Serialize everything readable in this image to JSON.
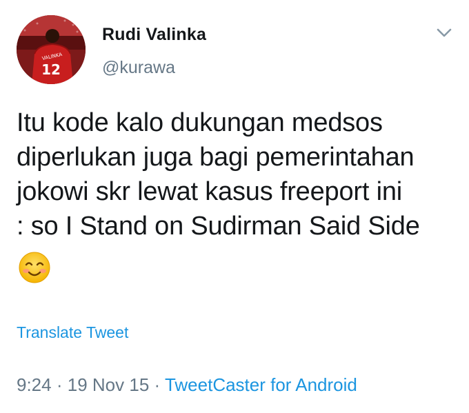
{
  "user": {
    "display_name": "Rudi Valinka",
    "handle": "@kurawa",
    "avatar_jersey_name": "VALINKA",
    "avatar_jersey_number": "12"
  },
  "tweet": {
    "text": "Itu kode kalo dukungan medsos\ndiperlukan juga bagi pemerintahan\njokowi skr lewat kasus freeport ini\n: so I Stand on Sudirman Said Side",
    "emoji": "☺️",
    "translate_label": "Translate Tweet"
  },
  "meta": {
    "time": "9:24",
    "date": "19 Nov 15",
    "separator": "·",
    "source": "TweetCaster for Android"
  },
  "icons": {
    "menu": "chevron-down-icon",
    "emoji": "smiling-face-icon"
  },
  "colors": {
    "link": "#1b95e0",
    "secondary_text": "#657786",
    "primary_text": "#14171a"
  }
}
